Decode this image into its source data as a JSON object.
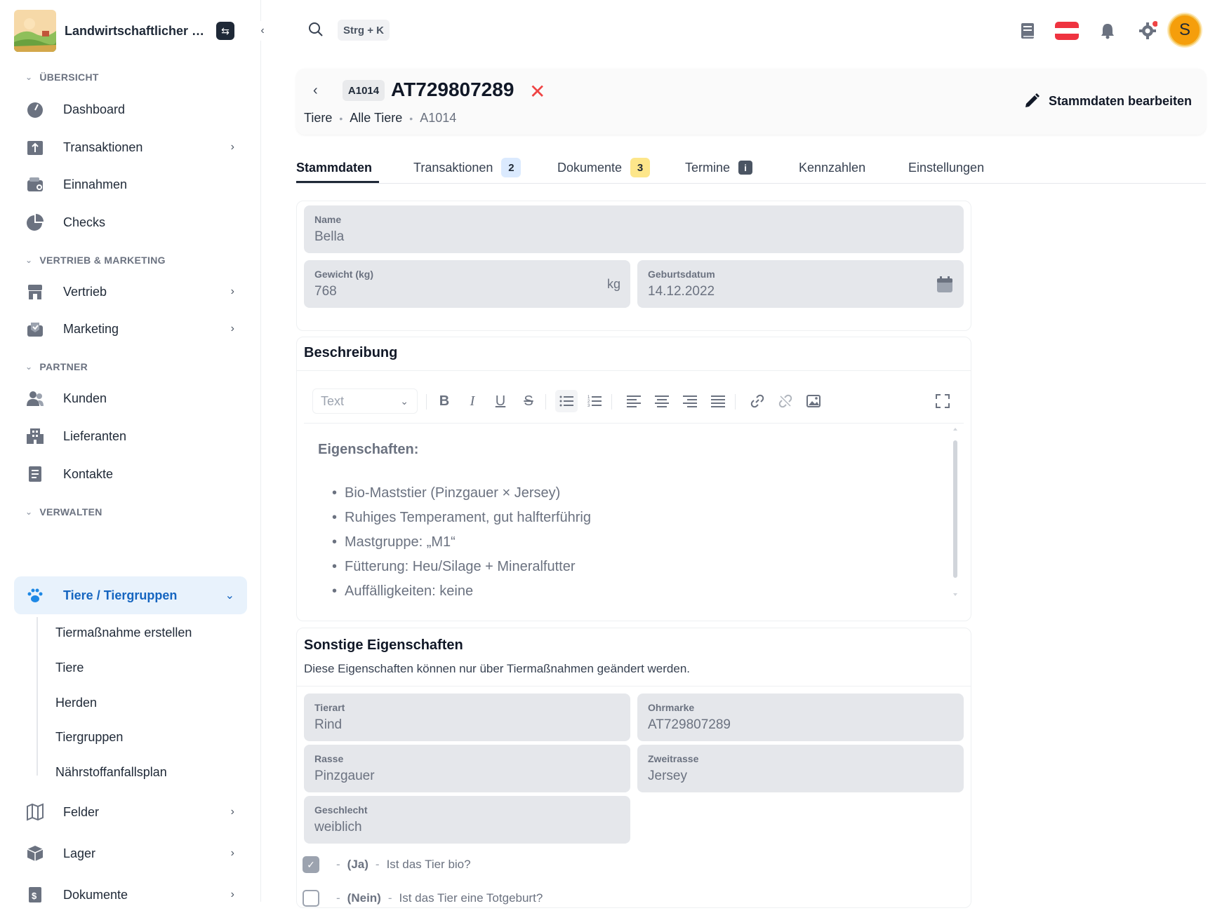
{
  "brand": {
    "name": "Landwirtschaftlicher Betrieb"
  },
  "sidebar": {
    "sections": [
      "ÜBERSICHT",
      "VERTRIEB & MARKETING",
      "PARTNER",
      "VERWALTEN"
    ],
    "items": [
      {
        "label": "Dashboard"
      },
      {
        "label": "Transaktionen"
      },
      {
        "label": "Einnahmen"
      },
      {
        "label": "Checks"
      },
      {
        "label": "Vertrieb"
      },
      {
        "label": "Marketing"
      },
      {
        "label": "Kunden"
      },
      {
        "label": "Lieferanten"
      },
      {
        "label": "Kontakte"
      },
      {
        "label": "Tiere / Tiergruppen"
      },
      {
        "label": "Felder"
      },
      {
        "label": "Lager"
      },
      {
        "label": "Dokumente"
      }
    ],
    "subitems": [
      "Tiermaßnahme erstellen",
      "Tiere",
      "Herden",
      "Tiergruppen",
      "Nährstoffanfallsplan"
    ]
  },
  "topbar": {
    "shortcut": "Strg + K",
    "avatar_letter": "S"
  },
  "header": {
    "tag": "A1014",
    "title": "AT729807289",
    "breadcrumb": [
      "Tiere",
      "Alle Tiere",
      "A1014"
    ],
    "edit_label": "Stammdaten bearbeiten"
  },
  "tabs": [
    {
      "label": "Stammdaten"
    },
    {
      "label": "Transaktionen",
      "badge": "2"
    },
    {
      "label": "Dokumente",
      "badge": "3"
    },
    {
      "label": "Termine",
      "badge": "i"
    },
    {
      "label": "Kennzahlen"
    },
    {
      "label": "Einstellungen"
    }
  ],
  "stammdaten": {
    "name_label": "Name",
    "name_value": "Bella",
    "gewicht_label": "Gewicht (kg)",
    "gewicht_value": "768",
    "gewicht_unit": "kg",
    "geburt_label": "Geburtsdatum",
    "geburt_value": "14.12.2022"
  },
  "beschreibung": {
    "title": "Beschreibung",
    "format_select": "Text",
    "heading": "Eigenschaften:",
    "bullets": [
      "Bio-Maststier (Pinzgauer × Jersey)",
      "Ruhiges Temperament, gut halfterführig",
      "Mastgruppe: „M1“",
      "Fütterung: Heu/Silage + Mineralfutter",
      "Auffälligkeiten: keine"
    ]
  },
  "sonstige": {
    "title": "Sonstige Eigenschaften",
    "subtitle": "Diese Eigenschaften können nur über Tiermaßnahmen geändert werden.",
    "tierart_label": "Tierart",
    "tierart_value": "Rind",
    "ohrmarke_label": "Ohrmarke",
    "ohrmarke_value": "AT729807289",
    "rasse_label": "Rasse",
    "rasse_value": "Pinzgauer",
    "zweitrasse_label": "Zweitrasse",
    "zweitrasse_value": "Jersey",
    "geschlecht_label": "Geschlecht",
    "geschlecht_value": "weiblich",
    "checks": [
      {
        "state": "(Ja)",
        "question": "Ist das Tier bio?",
        "checked": true
      },
      {
        "state": "(Nein)",
        "question": "Ist das Tier eine Totgeburt?",
        "checked": false
      }
    ]
  },
  "colors": {
    "accent": "#1565c0",
    "active_bg": "#e8f2fc",
    "danger": "#ef4444",
    "avatar": "#f59e0b"
  }
}
